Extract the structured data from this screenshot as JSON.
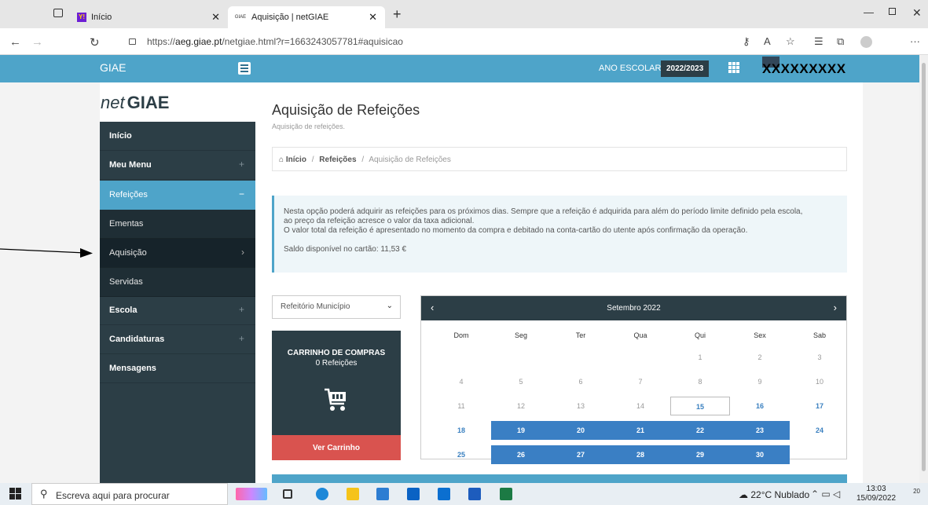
{
  "browser": {
    "tabs": [
      {
        "title": "Início",
        "favicon": "Y!"
      },
      {
        "title": "Aquisição | netGIAE",
        "favicon": "GIAE"
      }
    ],
    "url_prefix": "https://",
    "url_host": "aeg.giae.pt",
    "url_path": "/netgiae.html?r=1663243057781#aquisicao"
  },
  "header": {
    "brand": "GIAE",
    "ano_label": "ANO ESCOLAR",
    "ano_value": "2022/2023",
    "user_name": "XXXXXXXXX"
  },
  "logo": {
    "prefix": "net",
    "main": "GIAE"
  },
  "sidebar": {
    "items": [
      {
        "label": "Início",
        "toggle": ""
      },
      {
        "label": "Meu Menu",
        "toggle": "+"
      },
      {
        "label": "Refeições",
        "toggle": "−"
      },
      {
        "label": "Ementas",
        "toggle": ""
      },
      {
        "label": "Aquisição",
        "toggle": "›"
      },
      {
        "label": "Servidas",
        "toggle": ""
      },
      {
        "label": "Escola",
        "toggle": "+"
      },
      {
        "label": "Candidaturas",
        "toggle": "+"
      },
      {
        "label": "Mensagens",
        "toggle": ""
      }
    ]
  },
  "main": {
    "title": "Aquisição de Refeições",
    "subtitle": "Aquisição de refeições.",
    "breadcrumb": {
      "home": "Início",
      "sep": "/",
      "section": "Refeições",
      "current": "Aquisição de Refeições"
    },
    "info": {
      "line1": "Nesta opção poderá adquirir as refeições para os próximos dias. Sempre que a refeição é adquirida para além do período limite definido pela escola,",
      "line2": "ao preço da refeição acresce o valor da taxa adicional.",
      "line3": "O valor total da refeição é apresentado no momento da compra e debitado na conta-cartão do utente após confirmação da operação.",
      "saldo": "Saldo disponível no cartão: 11,53 €"
    },
    "restaurant": {
      "selected": "Refeitório Município"
    },
    "cart": {
      "title": "CARRINHO DE COMPRAS",
      "count": "0 Refeições",
      "button": "Ver Carrinho"
    },
    "calendar": {
      "month": "Setembro 2022",
      "weekdays": [
        "Dom",
        "Seg",
        "Ter",
        "Qua",
        "Qui",
        "Sex",
        "Sab"
      ],
      "weeks": [
        [
          "",
          "",
          "",
          "",
          "1",
          "2",
          "3"
        ],
        [
          "4",
          "5",
          "6",
          "7",
          "8",
          "9",
          "10"
        ],
        [
          "11",
          "12",
          "13",
          "14",
          "15",
          "16",
          "17"
        ],
        [
          "18",
          "19",
          "20",
          "21",
          "22",
          "23",
          "24"
        ],
        [
          "25",
          "26",
          "27",
          "28",
          "29",
          "30",
          ""
        ]
      ],
      "today": "15",
      "available": [
        "15",
        "16",
        "17",
        "18",
        "24",
        "25"
      ],
      "selected": [
        "19",
        "20",
        "21",
        "22",
        "23",
        "26",
        "27",
        "28",
        "29",
        "30"
      ]
    }
  },
  "taskbar": {
    "search_placeholder": "Escreva aqui para procurar",
    "weather": "22°C  Nublado",
    "time": "13:03",
    "date": "15/09/2022",
    "notifications": "20"
  },
  "colors": {
    "accent": "#4ea4c9",
    "dark": "#2c3e46",
    "danger": "#d9534f",
    "selected_day": "#3a7fc4"
  }
}
